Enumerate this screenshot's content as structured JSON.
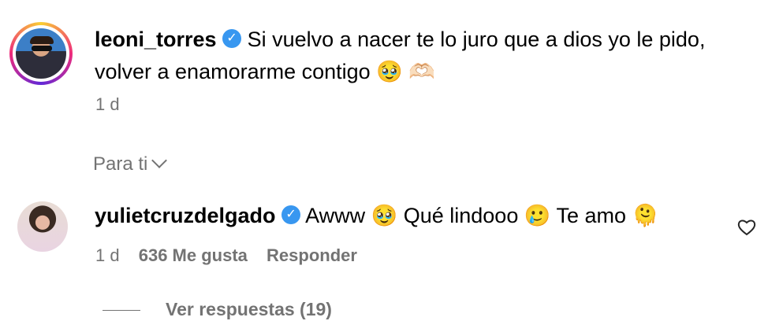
{
  "comments": [
    {
      "username": "leoni_torres",
      "text": "Si vuelvo a nacer te lo juro que a dios yo le pido, volver a enamorarme contigo 🥹 🫶🏻",
      "time": "1 d"
    },
    {
      "username": "yulietcruzdelgado",
      "text": "Awww 🥹 Qué lindooo 🥲 Te amo 🫠",
      "time": "1 d",
      "likes": "636 Me gusta",
      "reply_label": "Responder",
      "view_replies": "Ver respuestas (19)"
    }
  ],
  "sort_label": "Para ti",
  "icons": {
    "verified": "verified-badge-icon",
    "like": "heart-outline-icon",
    "sort": "chevron-down-icon"
  },
  "colors": {
    "verified": "#3897f0",
    "secondary_text": "#737373"
  }
}
